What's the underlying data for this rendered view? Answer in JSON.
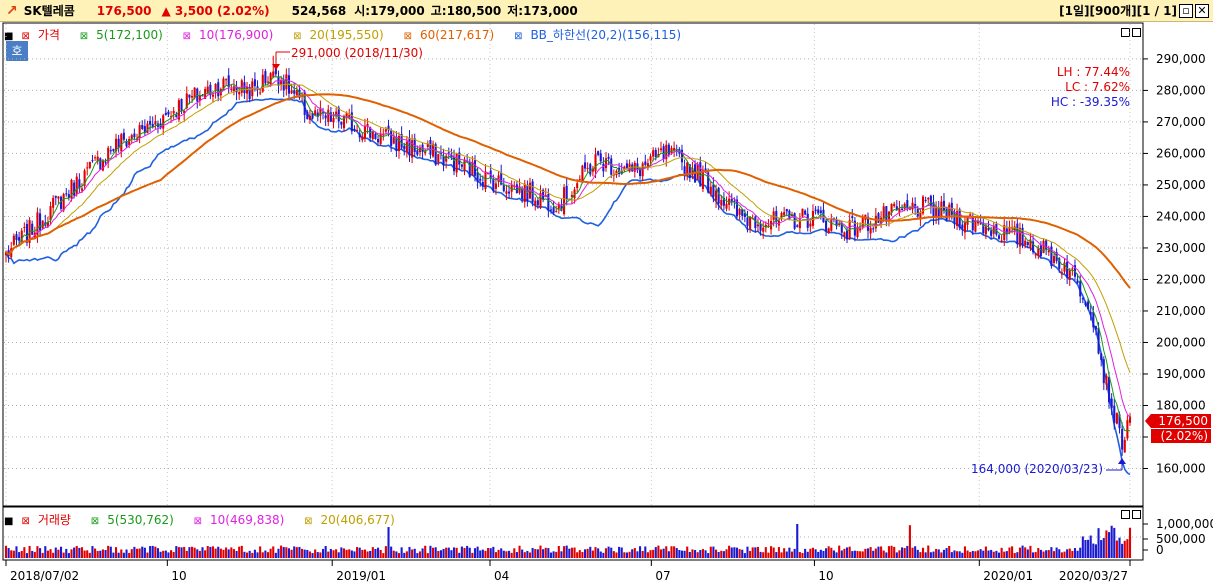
{
  "header": {
    "arrow_icon": "trend-up-arrow-icon",
    "stock_name": "SK텔레콤",
    "price": "176,500",
    "change": "▲ 3,500 (2.02%)",
    "volume": "524,568",
    "open": "시:179,000",
    "high": "고:180,500",
    "low": "저:173,000",
    "period_info": "[1일][900개][1 / 1]"
  },
  "price_panel": {
    "legend": {
      "price": "가격",
      "ma5": "5(172,100)",
      "ma10": "10(176,900)",
      "ma20": "20(195,550)",
      "ma60": "60(217,617)",
      "bb": "BB_하한선(20,2)(156,115)"
    },
    "hoga_button": "호",
    "stats": {
      "lh": "LH :  77.44%",
      "lc": "LC :   7.62%",
      "hc": "HC : -39.35%"
    },
    "max_annotation": "291,000 (2018/11/30)",
    "min_annotation": "164,000 (2020/03/23)",
    "last_price_tag": "176,500",
    "last_change_tag": "(2.02%)",
    "y_ticks": [
      "290,000",
      "280,000",
      "270,000",
      "260,000",
      "250,000",
      "240,000",
      "230,000",
      "220,000",
      "210,000",
      "200,000",
      "190,000",
      "180,000",
      "170,000",
      "160,000"
    ]
  },
  "volume_panel": {
    "legend": {
      "volume": "거래량",
      "ma5": "5(530,762)",
      "ma10": "10(469,838)",
      "ma20": "20(406,677)"
    },
    "y_ticks": [
      "1,000,000",
      "500,000",
      "0"
    ]
  },
  "x_ticks": [
    "2018/07/02",
    "10",
    "2019/01",
    "04",
    "07",
    "10",
    "2020/01",
    "2020/03/27"
  ],
  "colors": {
    "up": "#e00000",
    "down": "#1a1ad0",
    "ma5": "#1a9a1a",
    "ma10": "#e020e0",
    "ma20": "#c0a000",
    "ma60": "#e06000",
    "bb": "#2060e0"
  },
  "chart_data": {
    "type": "candlestick",
    "x_start": "2018/07/02",
    "x_end": "2020/03/27",
    "ylim": [
      150000,
      296000
    ],
    "close_trend": [
      [
        "2018/07/02",
        228000
      ],
      [
        "2018/07/20",
        238000
      ],
      [
        "2018/08/10",
        250000
      ],
      [
        "2018/08/31",
        262000
      ],
      [
        "2018/09/20",
        268000
      ],
      [
        "2018/10/10",
        276000
      ],
      [
        "2018/10/31",
        282000
      ],
      [
        "2018/11/20",
        280000
      ],
      [
        "2018/11/30",
        287000
      ],
      [
        "2018/12/20",
        272000
      ],
      [
        "2019/01/10",
        270000
      ],
      [
        "2019/01/31",
        265000
      ],
      [
        "2019/02/20",
        261000
      ],
      [
        "2019/03/10",
        258000
      ],
      [
        "2019/03/31",
        252000
      ],
      [
        "2019/04/20",
        248000
      ],
      [
        "2019/05/10",
        244000
      ],
      [
        "2019/05/31",
        258000
      ],
      [
        "2019/06/20",
        254000
      ],
      [
        "2019/07/10",
        260000
      ],
      [
        "2019/07/31",
        252000
      ],
      [
        "2019/08/20",
        240000
      ],
      [
        "2019/09/10",
        238000
      ],
      [
        "2019/09/30",
        240000
      ],
      [
        "2019/10/20",
        236000
      ],
      [
        "2019/11/10",
        240000
      ],
      [
        "2019/11/30",
        243000
      ],
      [
        "2019/12/20",
        240000
      ],
      [
        "2020/01/10",
        236000
      ],
      [
        "2020/01/31",
        232000
      ],
      [
        "2020/02/20",
        224000
      ],
      [
        "2020/03/05",
        212000
      ],
      [
        "2020/03/13",
        188000
      ],
      [
        "2020/03/23",
        167000
      ],
      [
        "2020/03/27",
        176500
      ]
    ],
    "max": {
      "date": "2018/11/30",
      "value": 291000
    },
    "min": {
      "date": "2020/03/23",
      "value": 164000
    },
    "last": 176500
  }
}
